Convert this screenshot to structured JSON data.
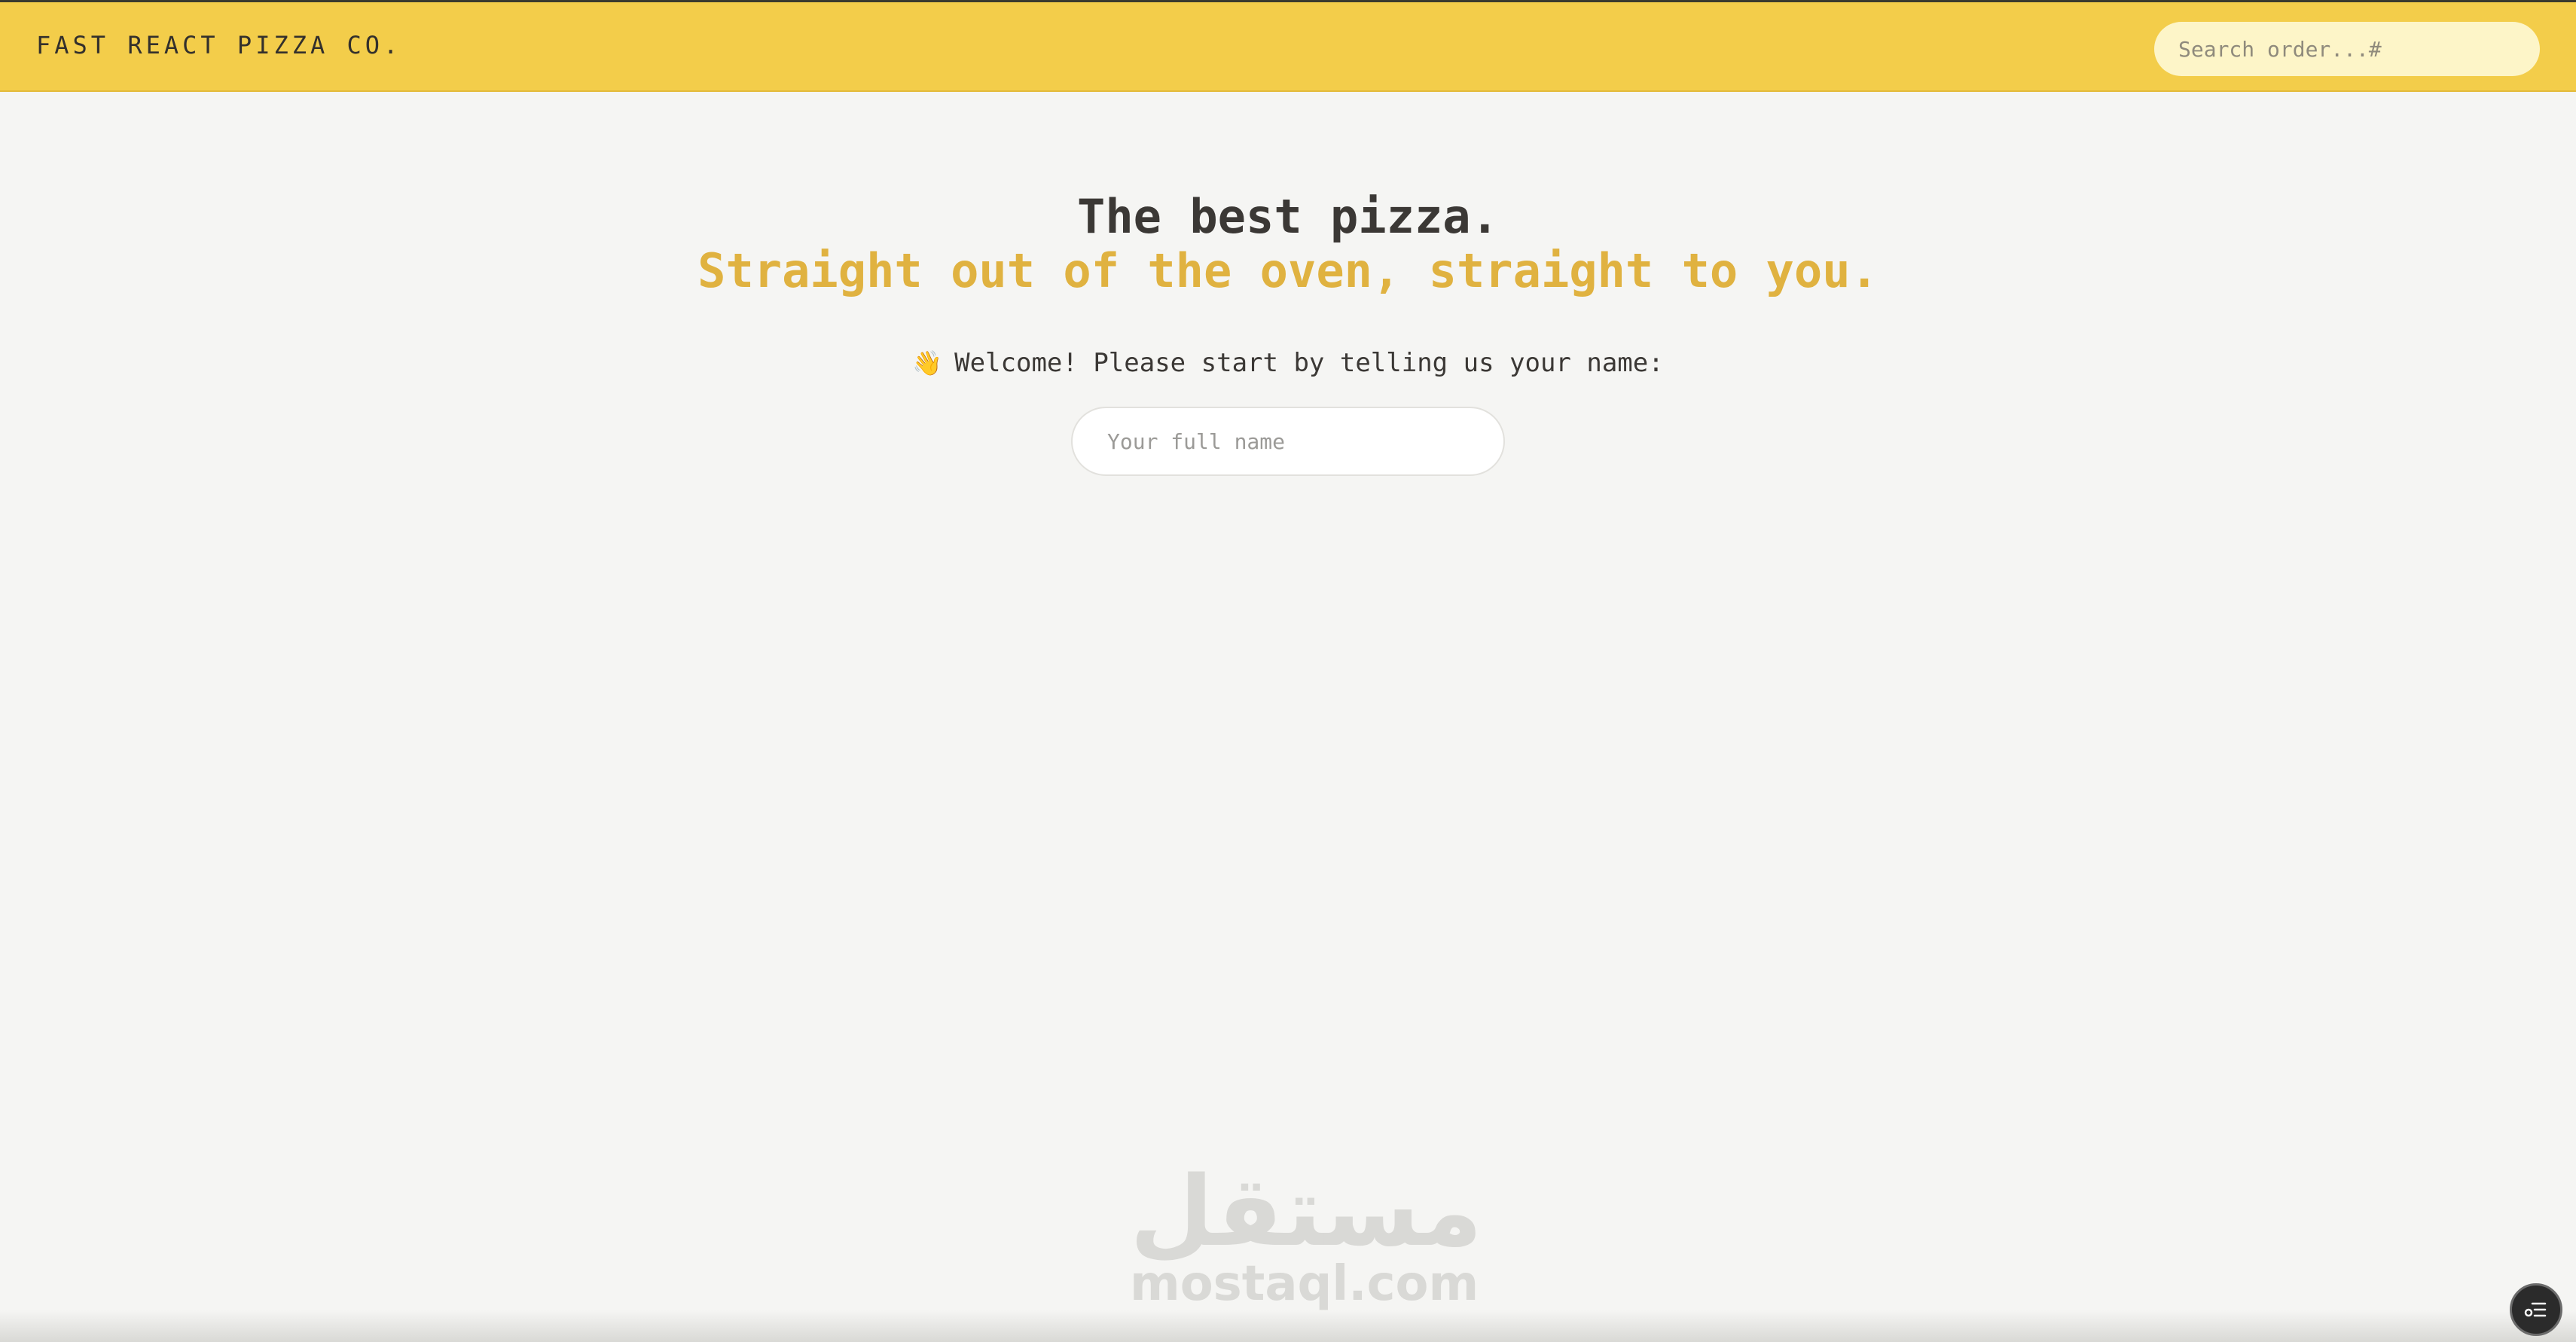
{
  "header": {
    "logo": "FAST REACT PIZZA CO.",
    "search_placeholder": "Search order...#"
  },
  "hero": {
    "title": "The best pizza.",
    "subtitle": "Straight out of the oven, straight to you."
  },
  "welcome": {
    "emoji": "👋",
    "text": "Welcome! Please start by telling us your name:",
    "name_placeholder": "Your full name"
  },
  "watermark": {
    "arabic": "مستقل",
    "latin": "mostaql.com"
  },
  "icons": {
    "wave": "waving-hand-icon",
    "fab": "menu-settings-icon"
  },
  "colors": {
    "header_bg": "#f3cd4a",
    "accent": "#e0b240",
    "page_bg": "#f5f5f3",
    "search_bg": "#fdf5c8"
  }
}
